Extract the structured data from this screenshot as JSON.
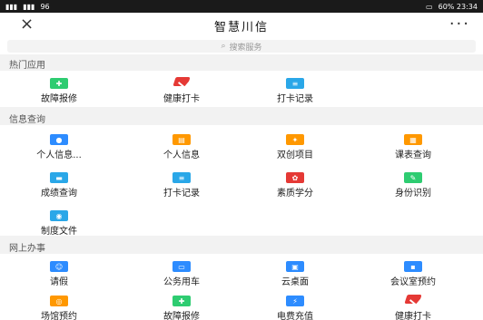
{
  "statusbar": {
    "left": "96",
    "right": "60% 23:34"
  },
  "appbar": {
    "title": "智慧川信",
    "close_icon": "close-icon",
    "more_icon": "more-icon"
  },
  "search": {
    "placeholder": "搜索服务",
    "icon": "search-icon"
  },
  "sections": [
    {
      "title": "热门应用",
      "items": [
        {
          "label": "故障报修",
          "icon": "repair-icon",
          "color": "#2ecc71"
        },
        {
          "label": "健康打卡",
          "icon": "health-checkin-icon",
          "color": "#e53935"
        },
        {
          "label": "打卡记录",
          "icon": "checkin-record-icon",
          "color": "#2aa7e8"
        }
      ]
    },
    {
      "title": "信息查询",
      "items": [
        {
          "label": "个人信息...",
          "icon": "profile-icon",
          "color": "#2d8cff"
        },
        {
          "label": "个人信息",
          "icon": "profile-card-icon",
          "color": "#ff9800"
        },
        {
          "label": "双创项目",
          "icon": "project-icon",
          "color": "#ff9800"
        },
        {
          "label": "课表查询",
          "icon": "timetable-icon",
          "color": "#ff9800"
        },
        {
          "label": "成绩查询",
          "icon": "grades-icon",
          "color": "#2aa7e8"
        },
        {
          "label": "打卡记录",
          "icon": "checkin-record-icon",
          "color": "#2aa7e8"
        },
        {
          "label": "素质学分",
          "icon": "credit-icon",
          "color": "#e53935"
        },
        {
          "label": "身份识别",
          "icon": "id-recognition-icon",
          "color": "#2ecc71"
        },
        {
          "label": "制度文件",
          "icon": "policy-document-icon",
          "color": "#2aa7e8"
        }
      ]
    },
    {
      "title": "网上办事",
      "items": [
        {
          "label": "请假",
          "icon": "leave-request-icon",
          "color": "#2d8cff"
        },
        {
          "label": "公务用车",
          "icon": "vehicle-icon",
          "color": "#2d8cff"
        },
        {
          "label": "云桌面",
          "icon": "cloud-desktop-icon",
          "color": "#2d8cff"
        },
        {
          "label": "会议室预约",
          "icon": "meeting-room-icon",
          "color": "#2d8cff"
        },
        {
          "label": "场馆预约",
          "icon": "venue-booking-icon",
          "color": "#ff9800"
        },
        {
          "label": "故障报修",
          "icon": "repair-icon",
          "color": "#2ecc71"
        },
        {
          "label": "电费充值",
          "icon": "electricity-recharge-icon",
          "color": "#2d8cff"
        },
        {
          "label": "健康打卡",
          "icon": "health-checkin-icon",
          "color": "#e53935"
        }
      ]
    }
  ]
}
